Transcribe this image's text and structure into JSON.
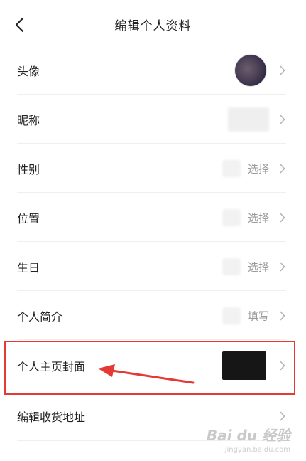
{
  "header": {
    "title": "编辑个人资料",
    "back_icon": "chevron-left-icon"
  },
  "rows": [
    {
      "label": "头像",
      "value": ""
    },
    {
      "label": "昵称",
      "value": ""
    },
    {
      "label": "性别",
      "value": "选择"
    },
    {
      "label": "位置",
      "value": "选择"
    },
    {
      "label": "生日",
      "value": "选择"
    },
    {
      "label": "个人简介",
      "value": "填写"
    },
    {
      "label": "个人主页封面",
      "value": ""
    },
    {
      "label": "编辑收货地址",
      "value": ""
    }
  ],
  "annotation": {
    "highlight_color": "#e53935"
  },
  "watermark": {
    "brand": "Bai du 经验",
    "url": "jingyan.baidu.com"
  }
}
